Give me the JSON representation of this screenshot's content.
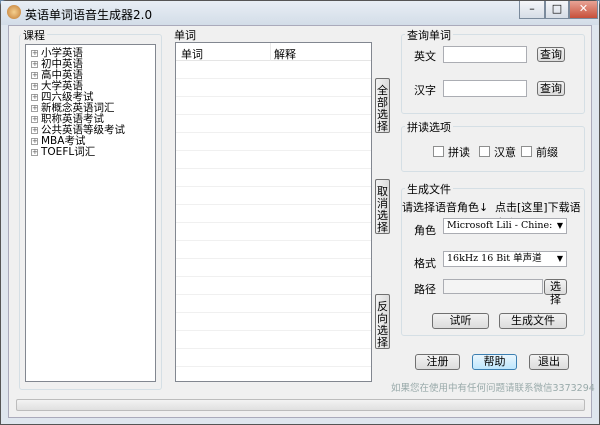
{
  "window": {
    "title": "英语单词语音生成器2.0",
    "min": "–",
    "max": "□",
    "close": "✕"
  },
  "courses": {
    "label": "课程",
    "items": [
      "小学英语",
      "初中英语",
      "高中英语",
      "大学英语",
      "四六级考试",
      "新概念英语词汇",
      "职称英语考试",
      "公共英语等级考试",
      "MBA考试",
      "TOEFL词汇"
    ]
  },
  "words": {
    "label": "单词",
    "col_word": "单词",
    "col_meaning": "解释"
  },
  "side_buttons": {
    "select_all": "全部选择",
    "deselect": "取消选择",
    "invert": "反向选择"
  },
  "lookup": {
    "label": "查询单词",
    "en_label": "英文",
    "en_value": "",
    "zh_label": "汉字",
    "zh_value": "",
    "query": "查询"
  },
  "spell": {
    "label": "拼读选项",
    "opts": [
      "拼读",
      "汉意",
      "前缀"
    ]
  },
  "gen": {
    "label": "生成文件",
    "hint": "请选择语音角色↓",
    "download": "点击[这里]下载语音库",
    "role_label": "角色",
    "role_value": "Microsoft Lili - Chine:",
    "format_label": "格式",
    "format_value": "16kHz 16 Bit 单声道",
    "path_label": "路径",
    "path_value": "",
    "choose": "选择",
    "listen": "试听",
    "generate": "生成文件"
  },
  "bottom": {
    "register": "注册",
    "help": "帮助",
    "exit": "退出",
    "contact": "如果您在使用中有任何问题请联系微信3373294"
  },
  "progress": 0
}
